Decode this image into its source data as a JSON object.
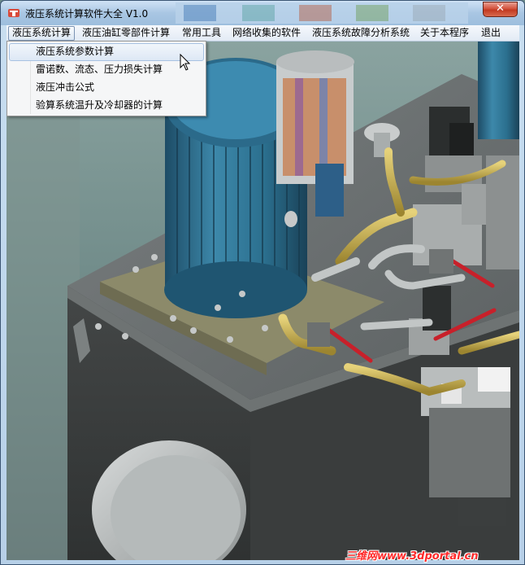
{
  "window": {
    "title": "液压系统计算软件大全  V1.0",
    "close_glyph": "✕"
  },
  "menubar": {
    "items": [
      {
        "label": "液压系统计算",
        "active": true
      },
      {
        "label": "液压油缸零部件计算"
      },
      {
        "label": "常用工具"
      },
      {
        "label": "网络收集的软件"
      },
      {
        "label": "液压系统故障分析系统"
      },
      {
        "label": "关于本程序"
      },
      {
        "label": "退出"
      }
    ]
  },
  "dropdown": {
    "items": [
      {
        "label": "液压系统参数计算",
        "hover": true
      },
      {
        "label": "雷诺数、流态、压力损失计算"
      },
      {
        "label": "液压冲击公式"
      },
      {
        "label": "验算系统温升及冷却器的计算"
      }
    ]
  },
  "watermark": "三维网www.3dportal.cn",
  "colors": {
    "menu_active_border": "#7b93b3",
    "motor_blue": "#2e6e8e",
    "tank_gray": "#4a4c4d",
    "pipe_yellow": "#c9b44a",
    "handle_red": "#c8202a",
    "watermark_red": "#ff2a2a"
  },
  "icons": [
    "app-icon",
    "close-icon",
    "cursor-icon"
  ]
}
